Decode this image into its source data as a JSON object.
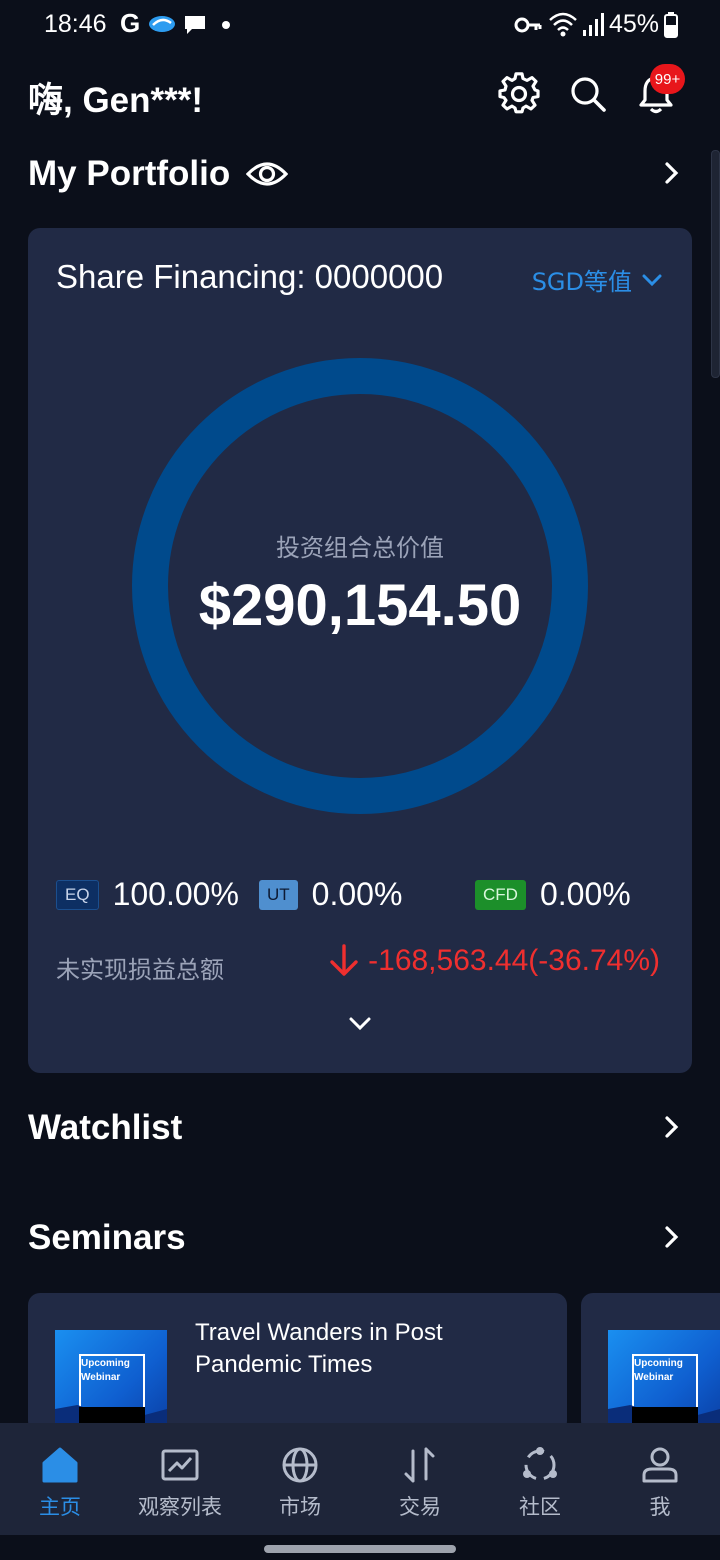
{
  "status_bar": {
    "time": "18:46",
    "google_glyph": "G",
    "battery": "45%"
  },
  "header": {
    "greeting": "嗨, Gen***!",
    "notification_badge": "99+"
  },
  "portfolio": {
    "title": "My Portfolio",
    "account": "Share Financing: 0000000",
    "currency": "SGD等值",
    "total_label": "投资组合总价值",
    "total_value": "$290,154.50",
    "donut_share_eq": 1.0,
    "allocations": [
      {
        "tag": "EQ",
        "pct": "100.00%"
      },
      {
        "tag": "UT",
        "pct": "0.00%"
      },
      {
        "tag": "CFD",
        "pct": "0.00%"
      }
    ],
    "pnl_label": "未实现损益总额",
    "pnl_value": "-168,563.44(-36.74%)"
  },
  "watchlist": {
    "title": "Watchlist"
  },
  "seminars": {
    "title": "Seminars",
    "thumb_text": "Upcoming Webinar",
    "cards": [
      {
        "title": "Travel Wanders in Post Pandemic Times"
      }
    ]
  },
  "bottom_nav": [
    {
      "label": "主页",
      "icon": "home-icon",
      "active": true
    },
    {
      "label": "观察列表",
      "icon": "chart-icon",
      "active": false
    },
    {
      "label": "市场",
      "icon": "globe-icon",
      "active": false
    },
    {
      "label": "交易",
      "icon": "trade-arrows-icon",
      "active": false
    },
    {
      "label": "社区",
      "icon": "community-icon",
      "active": false
    },
    {
      "label": "我",
      "icon": "profile-icon",
      "active": false
    }
  ],
  "colors": {
    "background": "#0b0f1a",
    "card": "#212a45",
    "accent": "#2b8ee6",
    "loss": "#ef2f2f",
    "donut": "#004a8c"
  }
}
